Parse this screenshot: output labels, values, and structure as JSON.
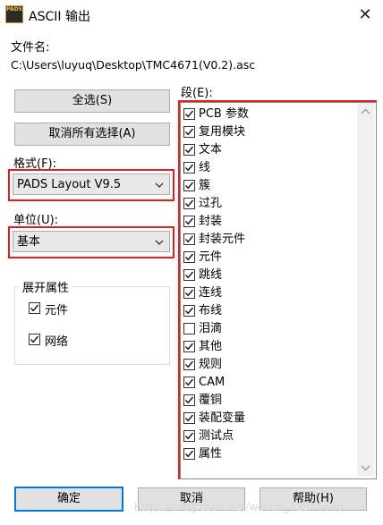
{
  "window": {
    "title": "ASCII 输出",
    "icon_text": "PADS",
    "close_glyph": "✕"
  },
  "file": {
    "label": "文件名:",
    "path": "C:\\Users\\luyuq\\Desktop\\TMC4671(V0.2).asc"
  },
  "buttons": {
    "select_all": "全选(S)",
    "deselect_all": "取消所有选择(A)",
    "ok": "确定",
    "cancel": "取消",
    "help": "帮助(H)"
  },
  "format": {
    "label": "格式(F):",
    "value": "PADS Layout V9.5"
  },
  "units": {
    "label": "单位(U):",
    "value": "基本"
  },
  "expand": {
    "label": "展开属性",
    "items": [
      {
        "label": "元件",
        "checked": true
      },
      {
        "label": "网络",
        "checked": true
      }
    ]
  },
  "sections": {
    "label": "段(E):",
    "items": [
      {
        "label": "PCB 参数",
        "checked": true
      },
      {
        "label": "复用模块",
        "checked": true
      },
      {
        "label": "文本",
        "checked": true
      },
      {
        "label": "线",
        "checked": true
      },
      {
        "label": "簇",
        "checked": true
      },
      {
        "label": "过孔",
        "checked": true
      },
      {
        "label": "封装",
        "checked": true
      },
      {
        "label": "封装元件",
        "checked": true
      },
      {
        "label": "元件",
        "checked": true
      },
      {
        "label": "跳线",
        "checked": true
      },
      {
        "label": "连线",
        "checked": true
      },
      {
        "label": "布线",
        "checked": true
      },
      {
        "label": "泪滴",
        "checked": false
      },
      {
        "label": "其他",
        "checked": true
      },
      {
        "label": "规则",
        "checked": true
      },
      {
        "label": "CAM",
        "checked": true
      },
      {
        "label": "覆铜",
        "checked": true
      },
      {
        "label": "装配变量",
        "checked": true
      },
      {
        "label": "测试点",
        "checked": true
      },
      {
        "label": "属性",
        "checked": true
      }
    ]
  },
  "watermark": "https://blog.csdn.net/weixin_41846646",
  "colors": {
    "highlight_border": "#e02020",
    "default_button_border": "#0078d7"
  }
}
